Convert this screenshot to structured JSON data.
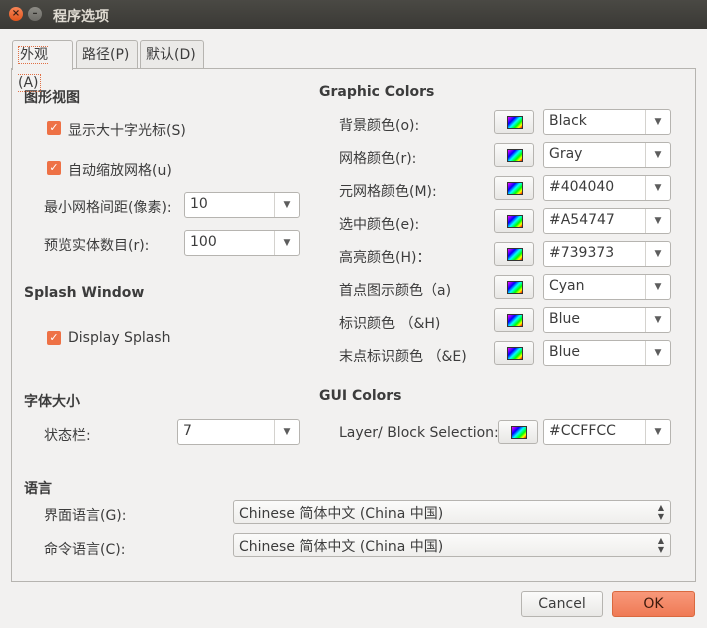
{
  "window": {
    "title": "程序选项"
  },
  "tabs": [
    {
      "label": "外观(A)",
      "active": true
    },
    {
      "label": "路径(P)",
      "active": false
    },
    {
      "label": "默认(D)",
      "active": false
    }
  ],
  "graphic_view": {
    "heading": "图形视图",
    "show_crosshair": {
      "label": "显示大十字光标(S)",
      "checked": true
    },
    "auto_scale_grid": {
      "label": "自动缩放网格(u)",
      "checked": true
    },
    "min_grid_spacing": {
      "label": "最小网格间距(像素):",
      "value": "10"
    },
    "preview_entities": {
      "label": "预览实体数目(r):",
      "value": "100"
    }
  },
  "splash": {
    "heading": "Splash Window",
    "display_splash": {
      "label": "Display Splash",
      "checked": true
    }
  },
  "font_size": {
    "heading": "字体大小",
    "statusbar": {
      "label": "状态栏:",
      "value": "7"
    }
  },
  "graphic_colors": {
    "heading": "Graphic Colors",
    "rows": [
      {
        "label": "背景颜色(o):",
        "value": "Black"
      },
      {
        "label": "网格颜色(r):",
        "value": "Gray"
      },
      {
        "label": "元网格颜色(M):",
        "value": "#404040"
      },
      {
        "label": "选中颜色(e):",
        "value": "#A54747"
      },
      {
        "label": "高亮颜色(H)：",
        "value": "#739373"
      },
      {
        "label": "首点图示颜色（a)",
        "value": "Cyan"
      },
      {
        "label": "标识颜色 （&H)",
        "value": "Blue"
      },
      {
        "label": "末点标识颜色 （&E)",
        "value": "Blue"
      }
    ]
  },
  "gui_colors": {
    "heading": "GUI Colors",
    "layer_block": {
      "label": "Layer/ Block Selection:",
      "value": "#CCFFCC"
    }
  },
  "language": {
    "heading": "语言",
    "ui_language": {
      "label": "界面语言(G):",
      "value": "Chinese 简体中文 (China 中国)"
    },
    "cmd_language": {
      "label": "命令语言(C):",
      "value": "Chinese 简体中文 (China 中国)"
    }
  },
  "buttons": {
    "cancel": "Cancel",
    "ok": "OK"
  },
  "colors": {
    "accent": "#ee7145",
    "titlebar": "#3c3b37",
    "background": "#f2f1f0"
  },
  "icons": {
    "close": "close-icon",
    "minimize": "minimize-icon",
    "dropdown": "chevron-down-icon",
    "swatch": "color-picker-icon"
  }
}
